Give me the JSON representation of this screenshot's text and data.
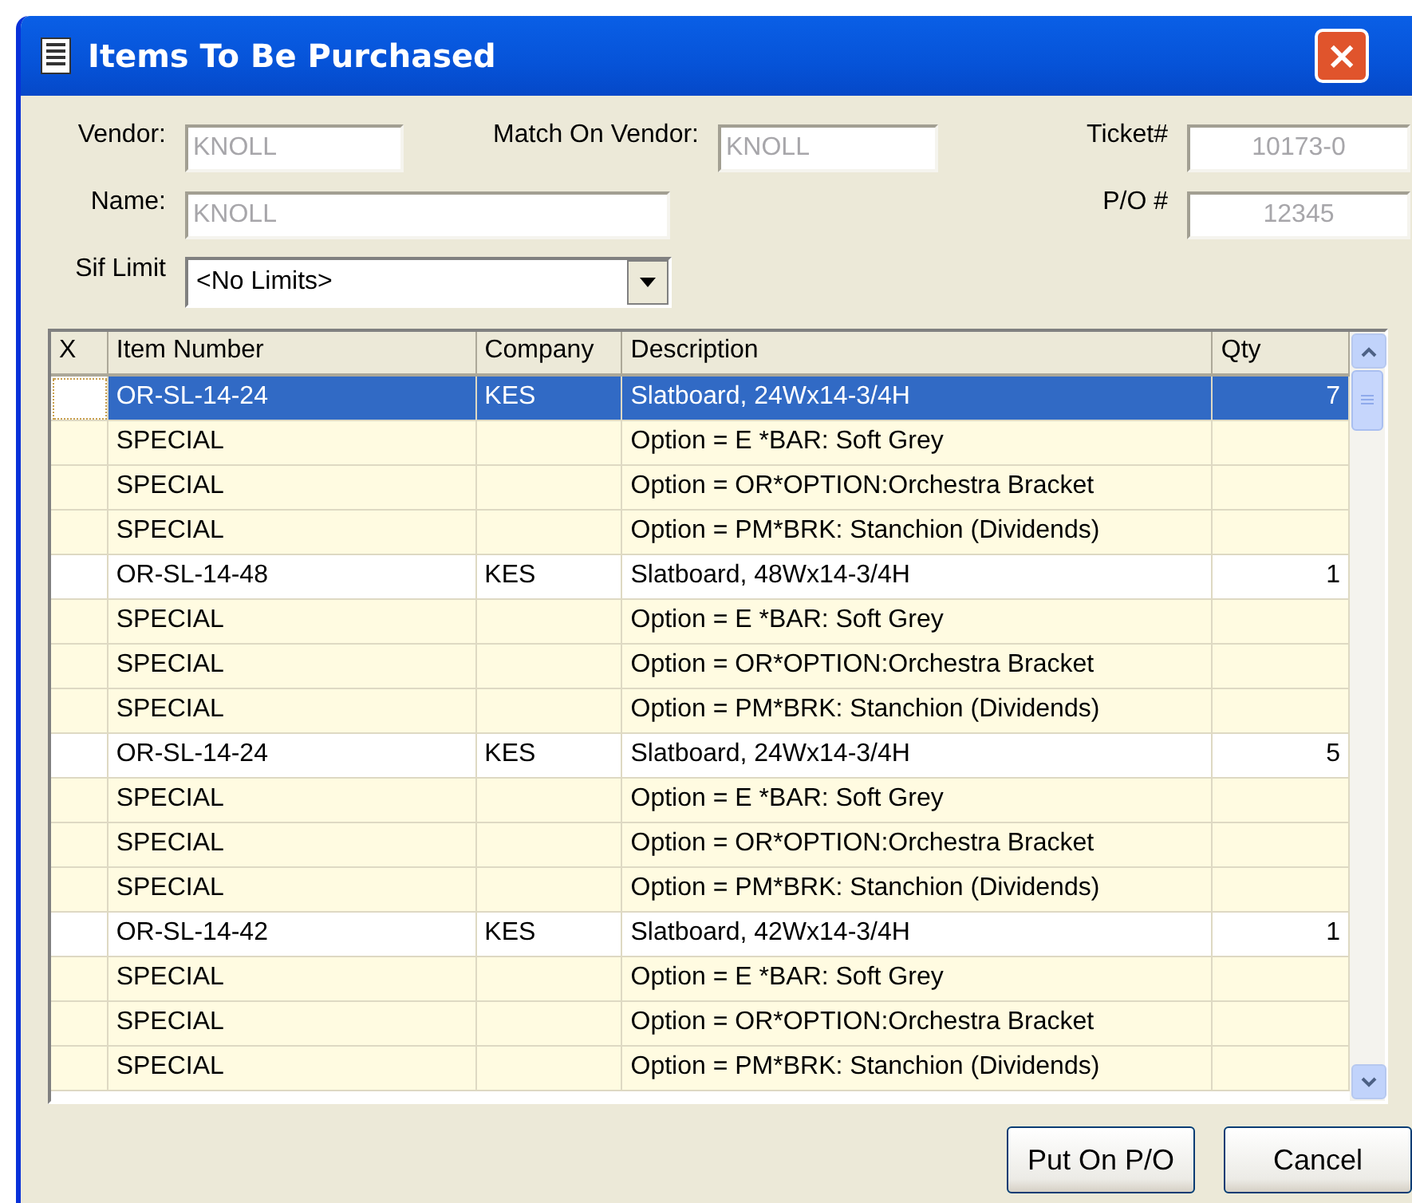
{
  "window": {
    "title": "Items To Be Purchased",
    "close": "×"
  },
  "form": {
    "vendor_label": "Vendor:",
    "vendor": "KNOLL",
    "match_label": "Match On Vendor:",
    "match": "KNOLL",
    "ticket_label": "Ticket#",
    "ticket": "10173-0",
    "name_label": "Name:",
    "name": "KNOLL",
    "po_label": "P/O #",
    "po": "12345",
    "sif_label": "Sif Limit",
    "sif": "<No Limits>"
  },
  "table": {
    "columns": [
      "X",
      "Item Number",
      "Company",
      "Description",
      "Qty"
    ],
    "rows": [
      {
        "kind": "item",
        "selected": true,
        "item": "OR-SL-14-24",
        "company": "KES",
        "description": "Slatboard, 24Wx14-3/4H",
        "qty": "7"
      },
      {
        "kind": "option",
        "selected": false,
        "item": "SPECIAL",
        "description": "Option = E *BAR: Soft Grey"
      },
      {
        "kind": "option",
        "selected": false,
        "item": "SPECIAL",
        "description": "Option = OR*OPTION:Orchestra Bracket"
      },
      {
        "kind": "option",
        "selected": false,
        "item": "SPECIAL",
        "description": "Option = PM*BRK: Stanchion (Dividends)"
      },
      {
        "kind": "item",
        "selected": false,
        "item": "OR-SL-14-48",
        "company": "KES",
        "description": "Slatboard, 48Wx14-3/4H",
        "qty": "1"
      },
      {
        "kind": "option",
        "selected": false,
        "item": "SPECIAL",
        "description": "Option = E *BAR: Soft Grey"
      },
      {
        "kind": "option",
        "selected": false,
        "item": "SPECIAL",
        "description": "Option = OR*OPTION:Orchestra Bracket"
      },
      {
        "kind": "option",
        "selected": false,
        "item": "SPECIAL",
        "description": "Option = PM*BRK: Stanchion (Dividends)"
      },
      {
        "kind": "item",
        "selected": false,
        "item": "OR-SL-14-24",
        "company": "KES",
        "description": "Slatboard, 24Wx14-3/4H",
        "qty": "5"
      },
      {
        "kind": "option",
        "selected": false,
        "item": "SPECIAL",
        "description": "Option = E *BAR: Soft Grey"
      },
      {
        "kind": "option",
        "selected": false,
        "item": "SPECIAL",
        "description": "Option = OR*OPTION:Orchestra Bracket"
      },
      {
        "kind": "option",
        "selected": false,
        "item": "SPECIAL",
        "description": "Option = PM*BRK: Stanchion (Dividends)"
      },
      {
        "kind": "item",
        "selected": false,
        "item": "OR-SL-14-42",
        "company": "KES",
        "description": "Slatboard, 42Wx14-3/4H",
        "qty": "1"
      },
      {
        "kind": "option",
        "selected": false,
        "item": "SPECIAL",
        "description": "Option = E *BAR: Soft Grey"
      },
      {
        "kind": "option",
        "selected": false,
        "item": "SPECIAL",
        "description": "Option = OR*OPTION:Orchestra Bracket"
      },
      {
        "kind": "option",
        "selected": false,
        "item": "SPECIAL",
        "description": "Option = PM*BRK: Stanchion (Dividends)"
      }
    ]
  },
  "buttons": [
    "Put On P/O",
    "Cancel"
  ]
}
